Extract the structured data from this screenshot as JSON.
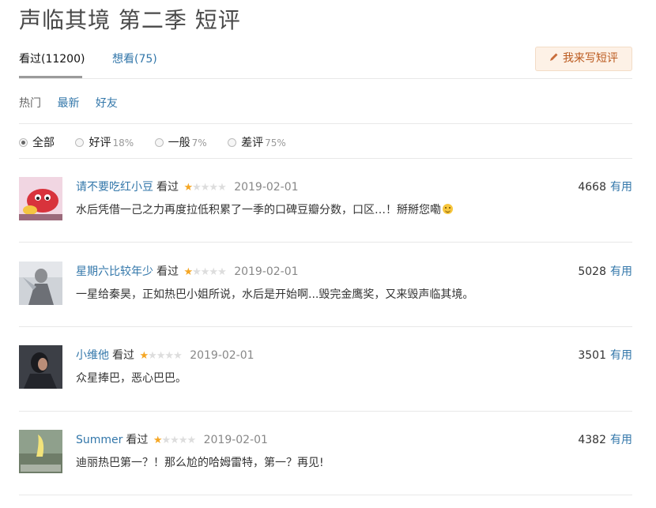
{
  "page": {
    "title": "声临其境 第二季 短评"
  },
  "tabs": {
    "watched": "看过(11200)",
    "want": "想看(75)"
  },
  "write_button": {
    "icon": "pencil-icon",
    "label": "我来写短评"
  },
  "sort": {
    "hot": "热门",
    "latest": "最新",
    "friends": "好友"
  },
  "filters": [
    {
      "label": "全部",
      "pct": "",
      "selected": true
    },
    {
      "label": "好评",
      "pct": "18%",
      "selected": false
    },
    {
      "label": "一般",
      "pct": "7%",
      "selected": false
    },
    {
      "label": "差评",
      "pct": "75%",
      "selected": false
    }
  ],
  "comments": [
    {
      "user": "请不要吃红小豆",
      "status": "看过",
      "rating": 1,
      "date": "2019-02-01",
      "votes": "4668",
      "useful_label": "有用",
      "text": "水后凭借一己之力再度拉低积累了一季的口碑豆瓣分数，口区…！掰掰您嘞"
    },
    {
      "user": "星期六比较年少",
      "status": "看过",
      "rating": 1,
      "date": "2019-02-01",
      "votes": "5028",
      "useful_label": "有用",
      "text": "一星给秦昊，正如热巴小姐所说，水后是开始啊...毁完金鹰奖，又来毁声临其境。"
    },
    {
      "user": "小维他",
      "status": "看过",
      "rating": 1,
      "date": "2019-02-01",
      "votes": "3501",
      "useful_label": "有用",
      "text": "众星捧巴，恶心巴巴。"
    },
    {
      "user": "Summer",
      "status": "看过",
      "rating": 1,
      "date": "2019-02-01",
      "votes": "4382",
      "useful_label": "有用",
      "text": "迪丽热巴第一？！那么尬的哈姆雷特，第一？再见!"
    }
  ]
}
